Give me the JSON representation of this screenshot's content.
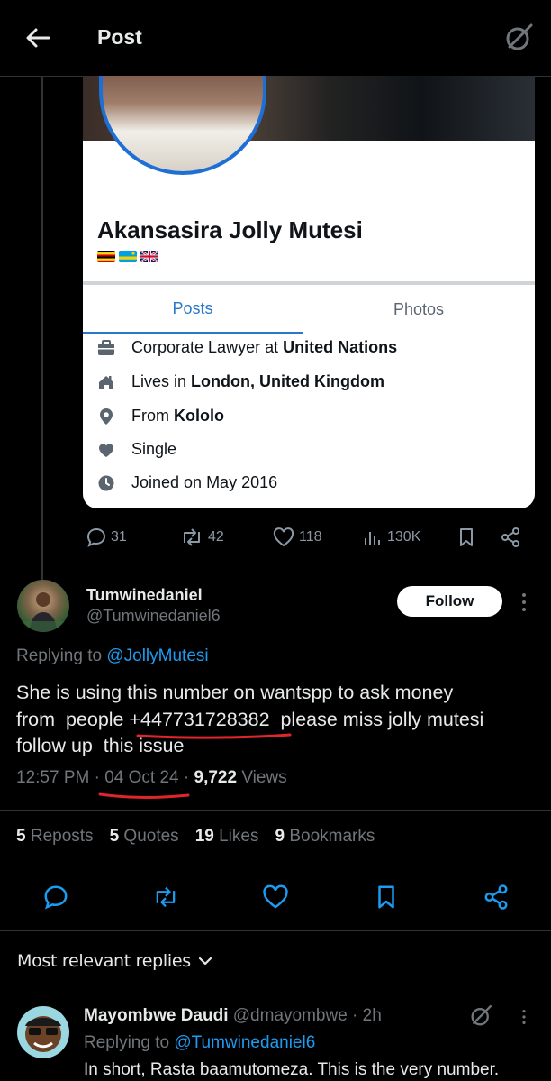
{
  "header": {
    "title": "Post"
  },
  "embedded_card": {
    "profile_name": "Akansasira Jolly Mutesi",
    "tabs": [
      {
        "label": "Posts"
      },
      {
        "label": "Photos"
      }
    ],
    "info": [
      {
        "icon": "briefcase-icon",
        "prefix": "Corporate Lawyer at ",
        "bold": "United Nations"
      },
      {
        "icon": "home-icon",
        "prefix": "Lives in ",
        "bold": "London, United Kingdom"
      },
      {
        "icon": "location-pin-icon",
        "prefix": "From ",
        "bold": "Kololo"
      },
      {
        "icon": "heart-icon",
        "prefix": "Single",
        "bold": ""
      },
      {
        "icon": "clock-icon",
        "prefix": "Joined on May 2016",
        "bold": ""
      }
    ]
  },
  "embedded_actions": {
    "replies": "31",
    "reposts": "42",
    "likes": "118",
    "views": "130K"
  },
  "tweet": {
    "author_name": "Tumwinedaniel",
    "author_handle": "@Tumwinedaniel6",
    "follow_label": "Follow",
    "replying_prefix": "Replying to ",
    "replying_handle": "@JollyMutesi",
    "text_line1": "She is using this number on wantspp to ask money",
    "text_line2": "from  people +447731728382  please miss jolly mutesi",
    "text_line3": "follow up  this issue",
    "time": "12:57 PM",
    "date": "04 Oct 24",
    "views_count": "9,722",
    "views_label": " Views"
  },
  "stats": {
    "reposts_count": "5",
    "reposts_label": "Reposts",
    "quotes_count": "5",
    "quotes_label": "Quotes",
    "likes_count": "19",
    "likes_label": "Likes",
    "bookmarks_count": "9",
    "bookmarks_label": "Bookmarks"
  },
  "replies_sort": {
    "label": "Most relevant replies"
  },
  "reply": {
    "name": "Mayombwe Daudi",
    "handle": "@dmayombwe",
    "time": "2h",
    "replying_prefix": "Replying to ",
    "replying_handle": "@Tumwinedaniel6",
    "text": "In short, Rasta baamutomeza. This is the very number."
  },
  "colors": {
    "accent": "#1d9bf0",
    "underline": "#e0252b",
    "background": "#000000"
  }
}
